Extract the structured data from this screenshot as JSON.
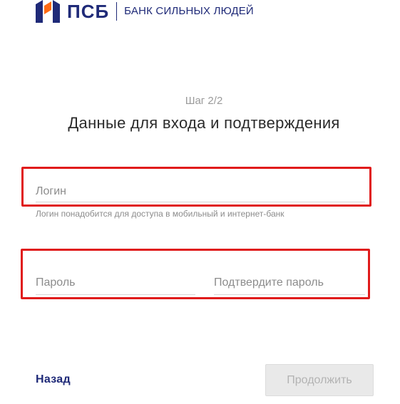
{
  "header": {
    "logo_icon": "psb-logo-icon",
    "brand_name": "ПСБ",
    "slogan": "БАНК СИЛЬНЫХ ЛЮДЕЙ",
    "brand_color": "#1f2a78",
    "logo_accent_color": "#ff6a13"
  },
  "form": {
    "step": "Шаг 2/2",
    "title": "Данные для входа и подтверждения",
    "login": {
      "placeholder": "Логин",
      "value": "",
      "hint": "Логин понадобится для доступа в мобильный и интернет-банк"
    },
    "password": {
      "placeholder": "Пароль",
      "value": ""
    },
    "confirm_password": {
      "placeholder": "Подтвердите пароль",
      "value": ""
    }
  },
  "footer": {
    "back_label": "Назад",
    "continue_label": "Продолжить"
  },
  "highlight_color": "#e01b1b"
}
